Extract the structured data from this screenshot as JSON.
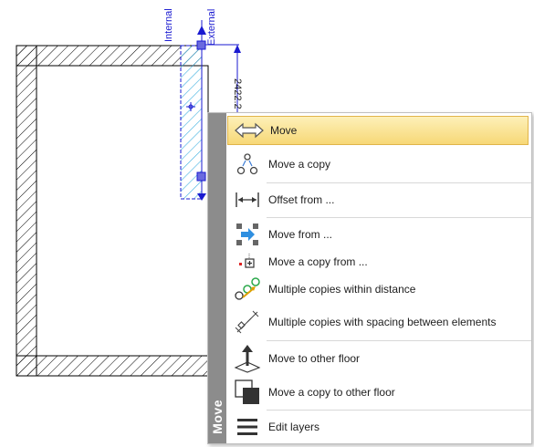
{
  "drawing": {
    "label_internal": "Internal",
    "label_external": "External",
    "dimension_value": "2422.2"
  },
  "menu": {
    "title": "Move",
    "items": [
      {
        "label": "Move",
        "icon": "double-arrow-icon",
        "highlighted": true
      },
      {
        "label": "Move a copy",
        "icon": "copy-nodes-icon"
      },
      {
        "label": "Offset from ...",
        "icon": "offset-icon"
      },
      {
        "label": "Move from ...",
        "icon": "move-from-icon"
      },
      {
        "label": "Move a copy from ...",
        "icon": "copy-from-icon"
      },
      {
        "label": "Multiple copies within distance",
        "icon": "multiple-copies-distance-icon"
      },
      {
        "label": "Multiple copies with spacing between elements",
        "icon": "multiple-copies-spacing-icon"
      },
      {
        "label": "Move to other floor",
        "icon": "move-floor-icon"
      },
      {
        "label": "Move a copy to other floor",
        "icon": "copy-floor-icon"
      },
      {
        "label": "Edit layers",
        "icon": "layers-icon"
      }
    ]
  },
  "colors": {
    "highlight": "#f7d877",
    "strip": "#8c8c8c",
    "selection": "#1a1ad0",
    "hatch_selected": "#3fb0e0"
  }
}
